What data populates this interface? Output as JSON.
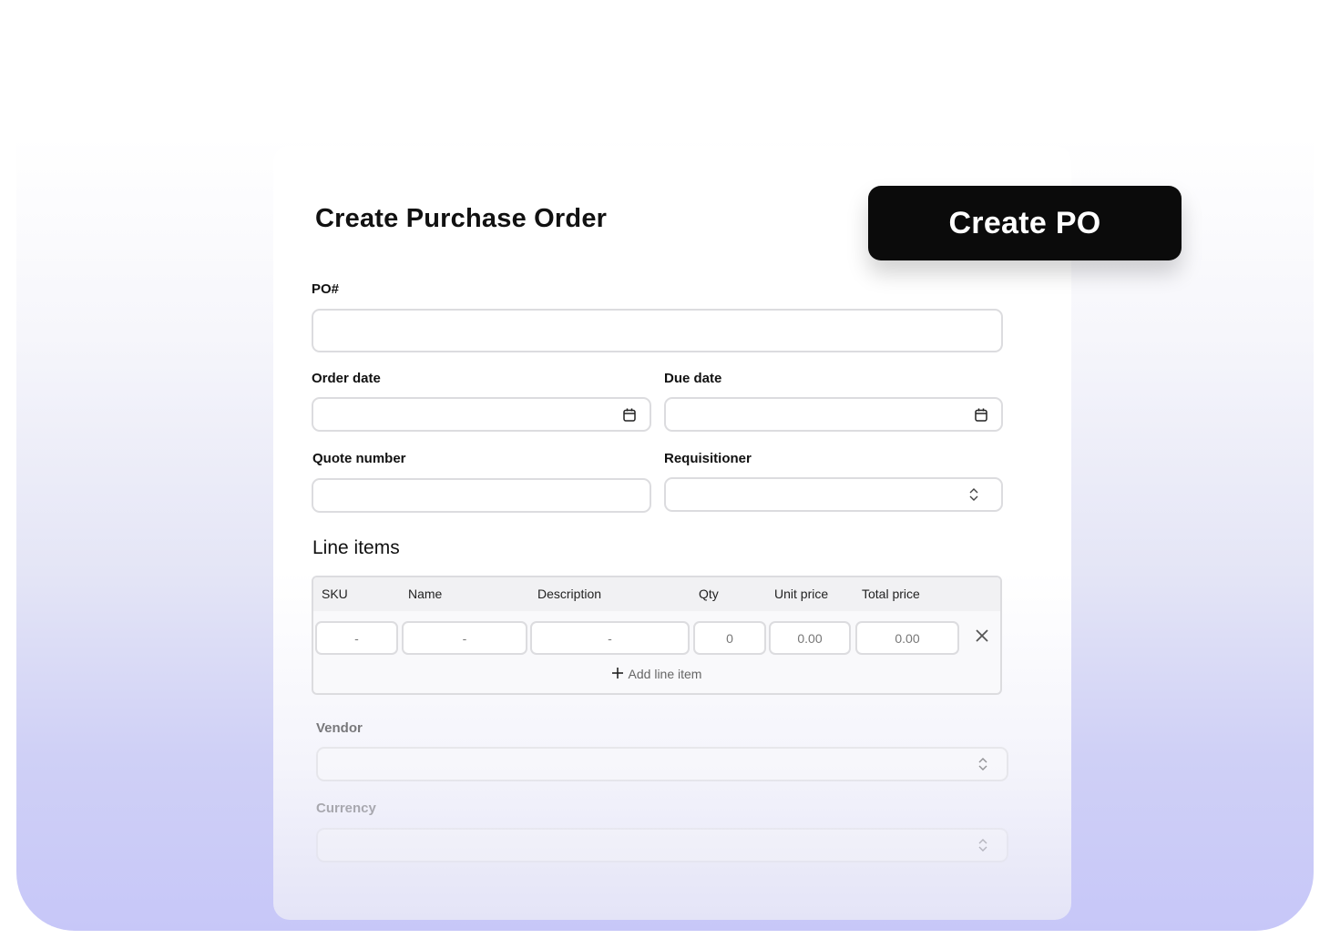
{
  "header": {
    "title": "Create Purchase Order",
    "create_button": "Create PO"
  },
  "form": {
    "po_number": {
      "label": "PO#",
      "value": ""
    },
    "order_date": {
      "label": "Order date",
      "value": "",
      "icon": "calendar-icon"
    },
    "due_date": {
      "label": "Due date",
      "value": "",
      "icon": "calendar-icon"
    },
    "quote_number": {
      "label": "Quote number",
      "value": ""
    },
    "requisitioner": {
      "label": "Requisitioner",
      "value": "",
      "icon": "chevron-updown-icon"
    },
    "vendor": {
      "label": "Vendor",
      "value": "",
      "icon": "chevron-updown-icon"
    },
    "currency": {
      "label": "Currency",
      "value": "",
      "icon": "chevron-updown-icon"
    }
  },
  "line_items": {
    "title": "Line items",
    "columns": [
      "SKU",
      "Name",
      "Description",
      "Qty",
      "Unit price",
      "Total price"
    ],
    "rows": [
      {
        "sku": "-",
        "name": "-",
        "description": "-",
        "qty": "0",
        "unit_price": "0.00",
        "total_price": "0.00"
      }
    ],
    "add_label": "Add line item",
    "remove_icon": "close-icon",
    "add_icon": "plus-icon"
  },
  "colors": {
    "button_bg": "#0b0b0b",
    "gradient_bottom": "#c7c7f8",
    "border": "#dcdcdf"
  }
}
